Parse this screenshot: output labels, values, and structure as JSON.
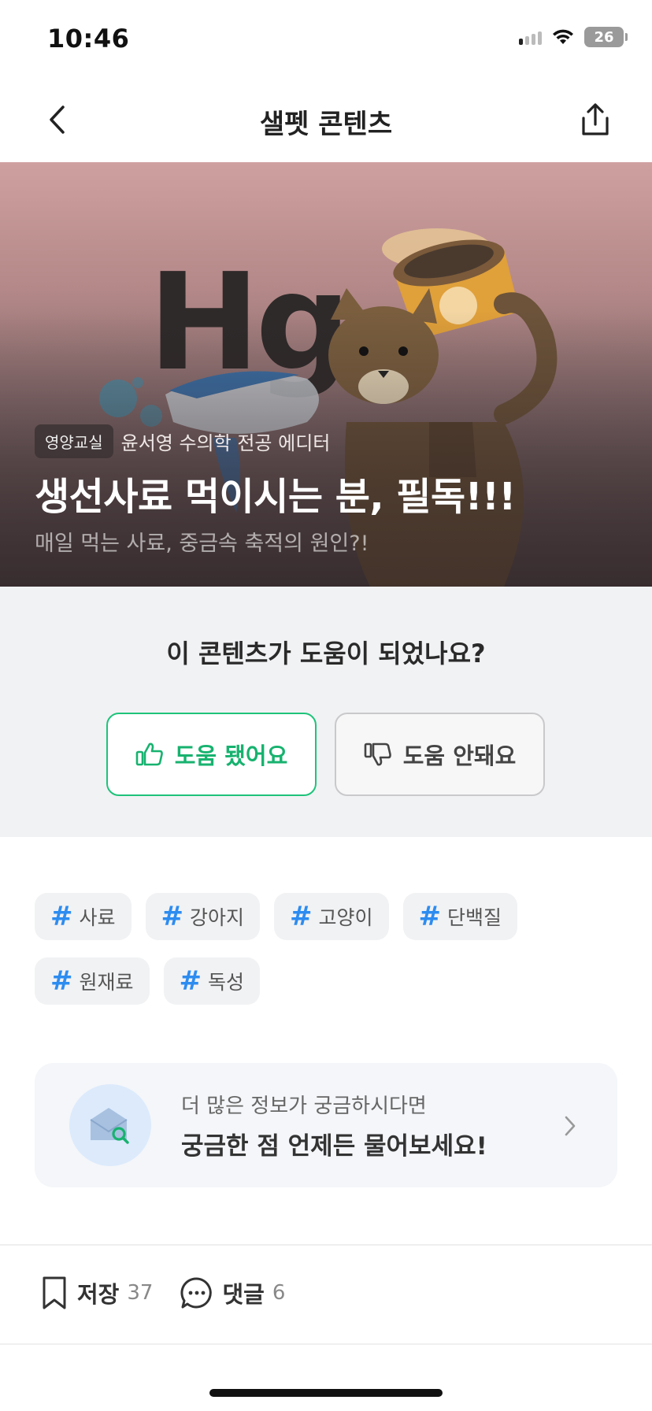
{
  "status_bar": {
    "time": "10:46",
    "battery": "26"
  },
  "nav": {
    "title": "샐펫 콘텐츠",
    "back_icon": "chevron-left-icon",
    "share_icon": "share-icon"
  },
  "hero": {
    "category": "영양교실",
    "author": "윤서영 수의학 전공 에디터",
    "title": "생선사료 먹이시는 분, 필독!!!",
    "subtitle": "매일 먹는 사료, 중금속 축적의 원인?!",
    "illustration_text": "Hg"
  },
  "feedback": {
    "question": "이 콘텐츠가 도움이 되었나요?",
    "yes_label": "도움 됐어요",
    "no_label": "도움 안돼요",
    "yes_color": "#17b26f"
  },
  "tags": [
    "사료",
    "강아지",
    "고양이",
    "단백질",
    "원재료",
    "독성"
  ],
  "inquiry": {
    "subtitle": "더 많은 정보가 궁금하시다면",
    "title": "궁금한 점 언제든 물어보세요!"
  },
  "actions": {
    "save_label": "저장",
    "save_count": "37",
    "comment_label": "댓글",
    "comment_count": "6"
  },
  "colors": {
    "accent_green": "#17b26f",
    "hash_blue": "#2d8cf0"
  }
}
